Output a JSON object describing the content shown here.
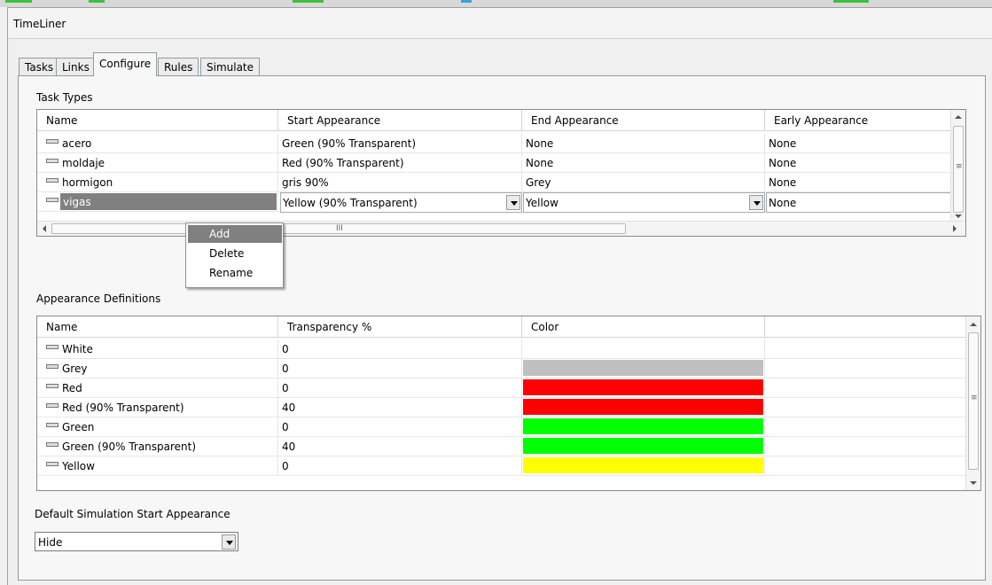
{
  "window": {
    "title": "TimeLiner"
  },
  "tabs": [
    {
      "label": "Tasks"
    },
    {
      "label": "Links"
    },
    {
      "label": "Configure"
    },
    {
      "label": "Rules"
    },
    {
      "label": "Simulate"
    }
  ],
  "active_tab": "Configure",
  "task_types": {
    "section_label": "Task Types",
    "columns": [
      "Name",
      "Start Appearance",
      "End Appearance",
      "Early Appearance"
    ],
    "rows": [
      {
        "name": "acero",
        "start": "Green (90% Transparent)",
        "end": "None",
        "early": "None"
      },
      {
        "name": "moldaje",
        "start": "Red (90% Transparent)",
        "end": "None",
        "early": "None"
      },
      {
        "name": "hormigon",
        "start": "gris 90%",
        "end": "Grey",
        "early": "None"
      },
      {
        "name": "vigas",
        "start": "Yellow (90% Transparent)",
        "end": "Yellow",
        "early": "None"
      }
    ],
    "selected_row": "vigas",
    "hscroll_grip": "III"
  },
  "context_menu": {
    "items": [
      {
        "label": "Add"
      },
      {
        "label": "Delete"
      },
      {
        "label": "Rename"
      }
    ],
    "highlighted": "Add"
  },
  "appearance_definitions": {
    "section_label": "Appearance Definitions",
    "columns": [
      "Name",
      "Transparency %",
      "Color"
    ],
    "rows": [
      {
        "name": "White",
        "transparency": "0",
        "color": "#ffffff"
      },
      {
        "name": "Grey",
        "transparency": "0",
        "color": "#c0c0c0"
      },
      {
        "name": "Red",
        "transparency": "0",
        "color": "#ff0000"
      },
      {
        "name": "Red (90% Transparent)",
        "transparency": "40",
        "color": "#ff0000"
      },
      {
        "name": "Green",
        "transparency": "0",
        "color": "#00ff00"
      },
      {
        "name": "Green (90% Transparent)",
        "transparency": "40",
        "color": "#00ff00"
      },
      {
        "name": "Yellow",
        "transparency": "0",
        "color": "#ffff00"
      }
    ]
  },
  "default_sim": {
    "label": "Default Simulation Start Appearance",
    "value": "Hide"
  },
  "colors": {
    "selection": "#808080",
    "panel": "#f7f7f7",
    "border": "#919b9c"
  },
  "icons": {
    "row_icon": "appearance-bar-icon",
    "dropdown": "chevron-down-icon",
    "scroll_up": "arrow-up-icon",
    "scroll_down": "arrow-down-icon",
    "scroll_left": "arrow-left-icon",
    "scroll_right": "arrow-right-icon"
  }
}
